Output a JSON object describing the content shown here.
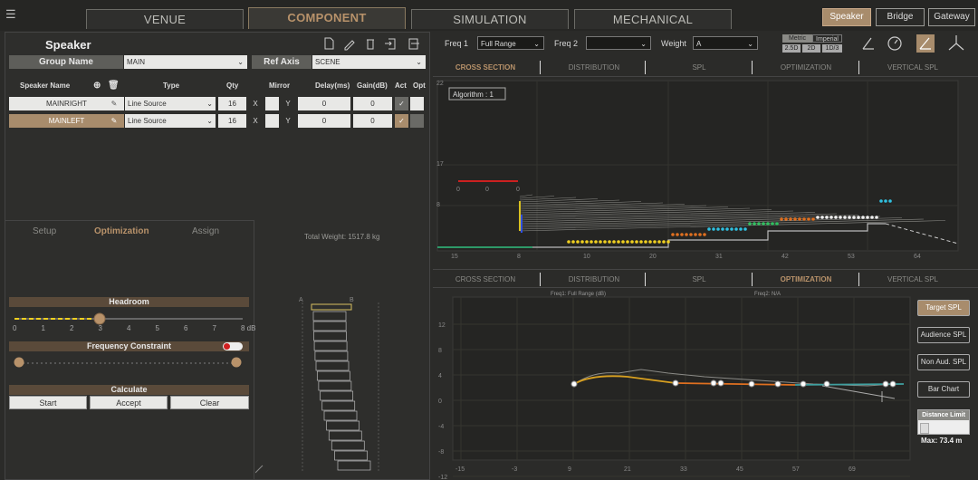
{
  "top": {
    "tabs": [
      "VENUE",
      "COMPONENT",
      "SIMULATION",
      "MECHANICAL"
    ],
    "right_tabs": [
      "Speaker",
      "Bridge",
      "Gateway"
    ]
  },
  "speaker": {
    "title": "Speaker",
    "group_label": "Group Name",
    "group_value": "MAIN",
    "ref_axis_label": "Ref Axis",
    "ref_axis_value": "SCENE",
    "columns": [
      "Speaker Name",
      "Type",
      "Qty",
      "Mirror",
      "Delay(ms)",
      "Gain(dB)",
      "Act",
      "Opt"
    ],
    "rows": [
      {
        "name": "MAINRIGHT",
        "type": "Line Source",
        "qty": "16",
        "x": "X",
        "mirror": "Y",
        "delay": "0",
        "gain": "0"
      },
      {
        "name": "MAINLEFT",
        "type": "Line Source",
        "qty": "16",
        "x": "X",
        "mirror": "Y",
        "delay": "0",
        "gain": "0"
      }
    ]
  },
  "subtabs": [
    "Setup",
    "Optimization",
    "Assign"
  ],
  "optimization": {
    "headroom_label": "Headroom",
    "headroom_ticks": [
      "0",
      "1",
      "2",
      "3",
      "4",
      "5",
      "6",
      "7",
      "8 dB"
    ],
    "headroom_value": 3,
    "freq_label": "Frequency Constraint",
    "calc_label": "Calculate",
    "start": "Start",
    "accept": "Accept",
    "clear": "Clear"
  },
  "array": {
    "total_weight": "Total Weight: 1517.8 kg",
    "left_marker": "A",
    "right_marker": "B"
  },
  "freq": {
    "freq1_label": "Freq 1",
    "freq1_value": "Full Range",
    "freq2_label": "Freq 2",
    "freq2_value": "",
    "weight_label": "Weight",
    "weight_value": "A",
    "metric": "Metric",
    "imperial": "Imperial",
    "zoom": [
      "2.5D",
      "2D",
      "1D/3"
    ]
  },
  "views_top": [
    "CROSS SECTION",
    "DISTRIBUTION",
    "SPL",
    "OPTIMIZATION",
    "VERTICAL SPL"
  ],
  "views_bottom": [
    "CROSS SECTION",
    "DISTRIBUTION",
    "SPL",
    "OPTIMIZATION",
    "VERTICAL SPL"
  ],
  "cross": {
    "algorithm": "Algorithm : 1",
    "yticks": [
      "22",
      "17",
      "8"
    ],
    "xticks": [
      "15",
      "8",
      "10",
      "20",
      "31",
      "42",
      "53",
      "64"
    ]
  },
  "opt_chart": {
    "legend1": "Freq1: Full Range (dB)",
    "legend2": "Freq2: N/A",
    "yticks": [
      "12",
      "8",
      "4",
      "0",
      "-4",
      "-8",
      "-12"
    ],
    "xticks": [
      "-15",
      "-3",
      "9",
      "21",
      "33",
      "45",
      "57",
      "69"
    ]
  },
  "sidebar": {
    "target": "Target SPL",
    "audience": "Audience SPL",
    "non_aud": "Non Aud. SPL",
    "bar": "Bar Chart",
    "distance": "Distance Limit",
    "max": "Max: 73.4 m"
  }
}
